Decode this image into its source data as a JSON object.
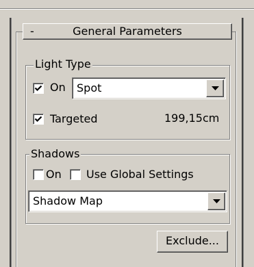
{
  "rollout": {
    "collapse_symbol": "-",
    "title": "General Parameters"
  },
  "light_type": {
    "group_label": "Light Type",
    "on_label": "On",
    "on_checked": true,
    "type_value": "Spot",
    "targeted_label": "Targeted",
    "targeted_checked": true,
    "target_distance": "199,15cm"
  },
  "shadows": {
    "group_label": "Shadows",
    "on_label": "On",
    "on_checked": false,
    "use_global_label": "Use Global Settings",
    "use_global_checked": false,
    "shadow_type_value": "Shadow Map",
    "exclude_label": "Exclude..."
  },
  "icons": {
    "check": "check-icon",
    "dropdown_arrow": "chevron-down-icon"
  },
  "colors": {
    "panel_bg": "#d4d0c8",
    "field_bg": "#ffffff",
    "shadow": "#808080",
    "dark_shadow": "#404040",
    "highlight": "#ffffff"
  }
}
